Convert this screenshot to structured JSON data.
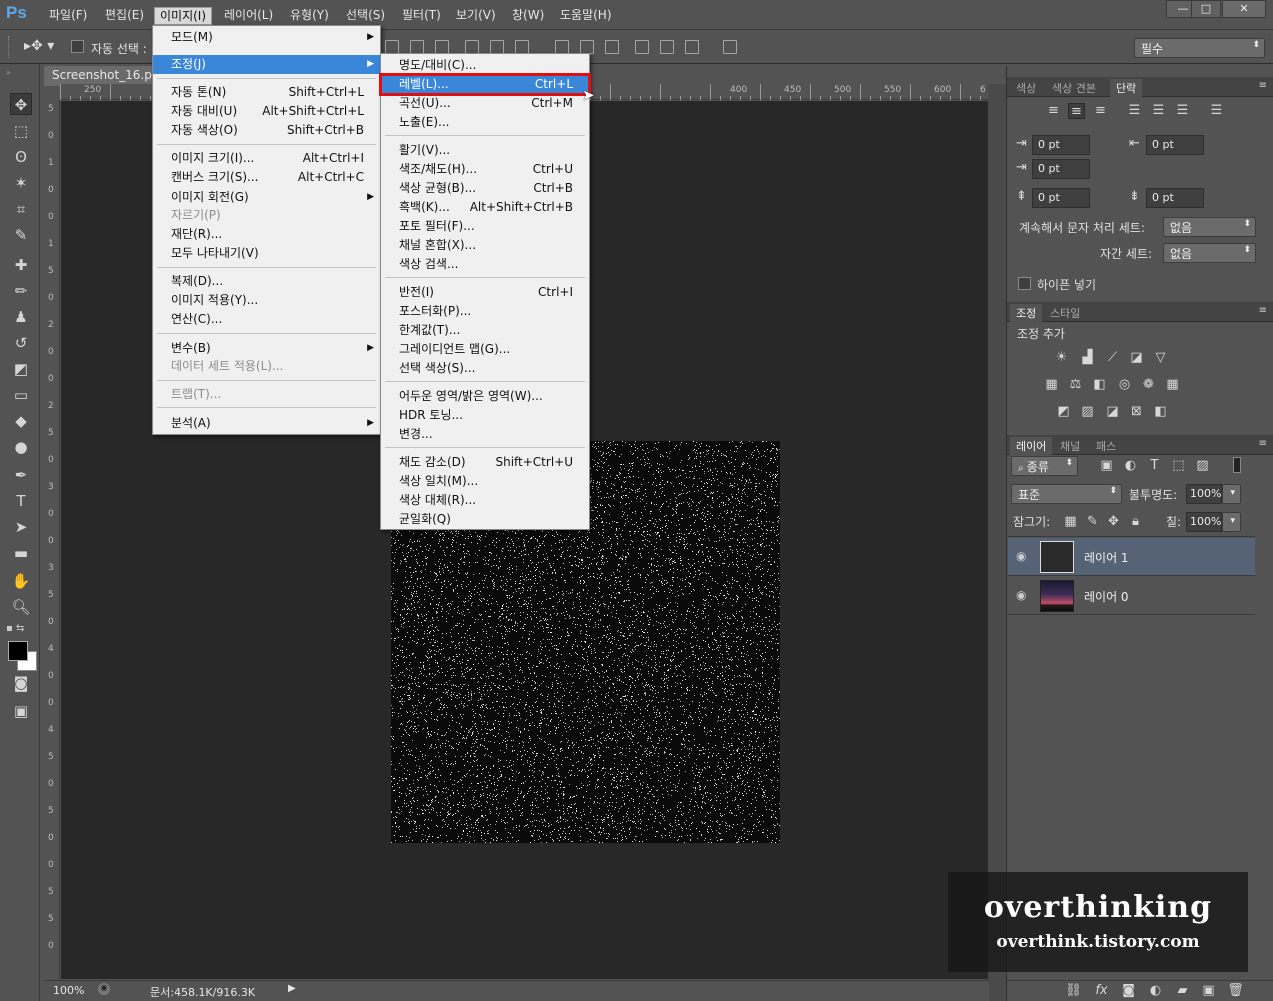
{
  "app": {
    "logo": "Ps"
  },
  "menubar": {
    "items": [
      "파일(F)",
      "편집(E)",
      "이미지(I)",
      "레이어(L)",
      "유형(Y)",
      "선택(S)",
      "필터(T)",
      "보기(V)",
      "창(W)",
      "도움말(H)"
    ],
    "open_index": 2
  },
  "window_controls": {
    "minimize": "—",
    "restore": "□",
    "close": "✕"
  },
  "options_bar": {
    "auto_select_label": "자동 선택 :",
    "workspace": "필수"
  },
  "document": {
    "tab_title": "Screenshot_16.png",
    "zoom": "100%",
    "status": "문서:458.1K/916.3K",
    "ruler_h": [
      "250",
      "400",
      "450",
      "500",
      "550",
      "600",
      "6"
    ],
    "ruler_v": [
      "5",
      "0",
      "1",
      "0",
      "0",
      "1",
      "5",
      "0",
      "2",
      "0",
      "0",
      "2",
      "5",
      "0",
      "3",
      "0",
      "0",
      "3",
      "5",
      "0",
      "4",
      "0",
      "0",
      "4",
      "5",
      "0",
      "5",
      "0",
      "0",
      "5",
      "5",
      "0"
    ]
  },
  "image_menu": {
    "items": [
      {
        "label": "모드(M)",
        "shortcut": "",
        "submenu": true,
        "disabled": false
      },
      {
        "label": "조정(J)",
        "shortcut": "",
        "submenu": true,
        "disabled": false,
        "highlight": true
      },
      {
        "label": "자동 톤(N)",
        "shortcut": "Shift+Ctrl+L",
        "submenu": false,
        "disabled": false
      },
      {
        "label": "자동 대비(U)",
        "shortcut": "Alt+Shift+Ctrl+L",
        "submenu": false,
        "disabled": false
      },
      {
        "label": "자동 색상(O)",
        "shortcut": "Shift+Ctrl+B",
        "submenu": false,
        "disabled": false
      },
      {
        "label": "이미지 크기(I)...",
        "shortcut": "Alt+Ctrl+I",
        "submenu": false,
        "disabled": false
      },
      {
        "label": "캔버스 크기(S)...",
        "shortcut": "Alt+Ctrl+C",
        "submenu": false,
        "disabled": false
      },
      {
        "label": "이미지 회전(G)",
        "shortcut": "",
        "submenu": true,
        "disabled": false
      },
      {
        "label": "자르기(P)",
        "shortcut": "",
        "submenu": false,
        "disabled": true
      },
      {
        "label": "재단(R)...",
        "shortcut": "",
        "submenu": false,
        "disabled": false
      },
      {
        "label": "모두 나타내기(V)",
        "shortcut": "",
        "submenu": false,
        "disabled": false
      },
      {
        "label": "복제(D)...",
        "shortcut": "",
        "submenu": false,
        "disabled": false
      },
      {
        "label": "이미지 적용(Y)...",
        "shortcut": "",
        "submenu": false,
        "disabled": false
      },
      {
        "label": "연산(C)...",
        "shortcut": "",
        "submenu": false,
        "disabled": false
      },
      {
        "label": "변수(B)",
        "shortcut": "",
        "submenu": true,
        "disabled": false
      },
      {
        "label": "데이터 세트 적용(L)...",
        "shortcut": "",
        "submenu": false,
        "disabled": true
      },
      {
        "label": "트랩(T)...",
        "shortcut": "",
        "submenu": false,
        "disabled": true
      },
      {
        "label": "분석(A)",
        "shortcut": "",
        "submenu": true,
        "disabled": false
      }
    ]
  },
  "adjust_menu": {
    "items": [
      {
        "label": "명도/대비(C)...",
        "shortcut": ""
      },
      {
        "label": "레벨(L)...",
        "shortcut": "Ctrl+L",
        "highlight": true
      },
      {
        "label": "곡선(U)...",
        "shortcut": "Ctrl+M"
      },
      {
        "label": "노출(E)...",
        "shortcut": ""
      },
      {
        "label": "활기(V)...",
        "shortcut": ""
      },
      {
        "label": "색조/채도(H)...",
        "shortcut": "Ctrl+U"
      },
      {
        "label": "색상 균형(B)...",
        "shortcut": "Ctrl+B"
      },
      {
        "label": "흑백(K)...",
        "shortcut": "Alt+Shift+Ctrl+B"
      },
      {
        "label": "포토 필터(F)...",
        "shortcut": ""
      },
      {
        "label": "채널 혼합(X)...",
        "shortcut": ""
      },
      {
        "label": "색상 검색...",
        "shortcut": ""
      },
      {
        "label": "반전(I)",
        "shortcut": "Ctrl+I"
      },
      {
        "label": "포스터화(P)...",
        "shortcut": ""
      },
      {
        "label": "한계값(T)...",
        "shortcut": ""
      },
      {
        "label": "그레이디언트 맵(G)...",
        "shortcut": ""
      },
      {
        "label": "선택 색상(S)...",
        "shortcut": ""
      },
      {
        "label": "어두운 영역/밝은 영역(W)...",
        "shortcut": ""
      },
      {
        "label": "HDR 토닝...",
        "shortcut": ""
      },
      {
        "label": "변경...",
        "shortcut": ""
      },
      {
        "label": "채도 감소(D)",
        "shortcut": "Shift+Ctrl+U"
      },
      {
        "label": "색상 일치(M)...",
        "shortcut": ""
      },
      {
        "label": "색상 대체(R)...",
        "shortcut": ""
      },
      {
        "label": "균일화(Q)",
        "shortcut": ""
      }
    ]
  },
  "paragraph_panel": {
    "tabs": [
      "색상",
      "색상 견본",
      "단락"
    ],
    "active_tab": "단락",
    "indent_left": "0 pt",
    "indent_right": "0 pt",
    "indent_first": "0 pt",
    "space_before": "0 pt",
    "space_after": "0 pt",
    "kinsoku_label": "계속해서 문자 처리 세트:",
    "kinsoku_value": "없음",
    "mojikumi_label": "자간 세트:",
    "mojikumi_value": "없음",
    "hyphen_label": "하이픈 넣기"
  },
  "adjust_panel": {
    "tabs": [
      "조정",
      "스타일"
    ],
    "add_label": "조정 추가"
  },
  "layers_panel": {
    "tabs": [
      "레이어",
      "채널",
      "패스"
    ],
    "filter_kind": "종류",
    "blend_mode": "표준",
    "opacity_label": "불투명도:",
    "opacity": "100%",
    "lock_label": "잠그기:",
    "fill_label": "칠:",
    "fill": "100%",
    "layers": [
      {
        "name": "레이어 1",
        "selected": true
      },
      {
        "name": "레이어 0",
        "selected": false
      }
    ]
  },
  "watermark": {
    "title": "overthinking",
    "url": "overthink.tistory.com"
  },
  "colors": {
    "highlight": "#3a86d8",
    "callout": "#e01010",
    "selected_layer": "#566275"
  }
}
